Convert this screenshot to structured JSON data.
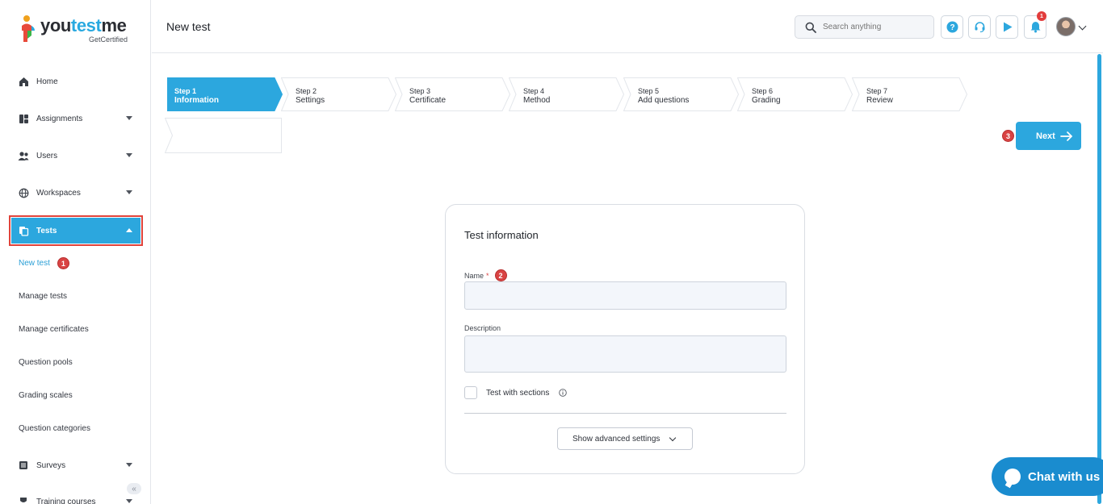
{
  "app": {
    "logo_text_part1": "you",
    "logo_text_part2": "test",
    "logo_text_part3": "me",
    "logo_subtitle": "GetCertified"
  },
  "header": {
    "title": "New test",
    "search_placeholder": "Search anything",
    "notification_count": "1"
  },
  "sidebar": {
    "items": [
      {
        "label": "Home",
        "icon": "home-icon"
      },
      {
        "label": "Assignments",
        "icon": "assignments-icon"
      },
      {
        "label": "Users",
        "icon": "users-icon"
      },
      {
        "label": "Workspaces",
        "icon": "globe-icon"
      },
      {
        "label": "Tests",
        "icon": "tests-icon"
      },
      {
        "label": "Surveys",
        "icon": "surveys-icon"
      },
      {
        "label": "Training courses",
        "icon": "training-icon"
      }
    ],
    "sub_items": [
      {
        "label": "New test"
      },
      {
        "label": "Manage tests"
      },
      {
        "label": "Manage certificates"
      },
      {
        "label": "Question pools"
      },
      {
        "label": "Grading scales"
      },
      {
        "label": "Question categories"
      }
    ],
    "collapse_glyph": "«"
  },
  "steps": [
    {
      "step": "Step 1",
      "name": "Information",
      "active": true
    },
    {
      "step": "Step 2",
      "name": "Settings",
      "active": false
    },
    {
      "step": "Step 3",
      "name": "Certificate",
      "active": false
    },
    {
      "step": "Step 4",
      "name": "Method",
      "active": false
    },
    {
      "step": "Step 5",
      "name": "Add questions",
      "active": false
    },
    {
      "step": "Step 6",
      "name": "Grading",
      "active": false
    },
    {
      "step": "Step 7",
      "name": "Review",
      "active": false
    }
  ],
  "next_button": {
    "label": "Next"
  },
  "form": {
    "title": "Test information",
    "name_label": "Name",
    "required_mark": "*",
    "name_value": "",
    "description_label": "Description",
    "description_value": "",
    "sections_checkbox_label": "Test with sections",
    "sections_checked": false,
    "advanced_button": "Show advanced settings"
  },
  "markers": [
    "1",
    "2",
    "3"
  ],
  "chat": {
    "label": "Chat with us"
  },
  "colors": {
    "accent": "#2ca7de",
    "highlight_border": "#e0433b",
    "marker": "#d94343",
    "chat": "#1a8ccf"
  }
}
